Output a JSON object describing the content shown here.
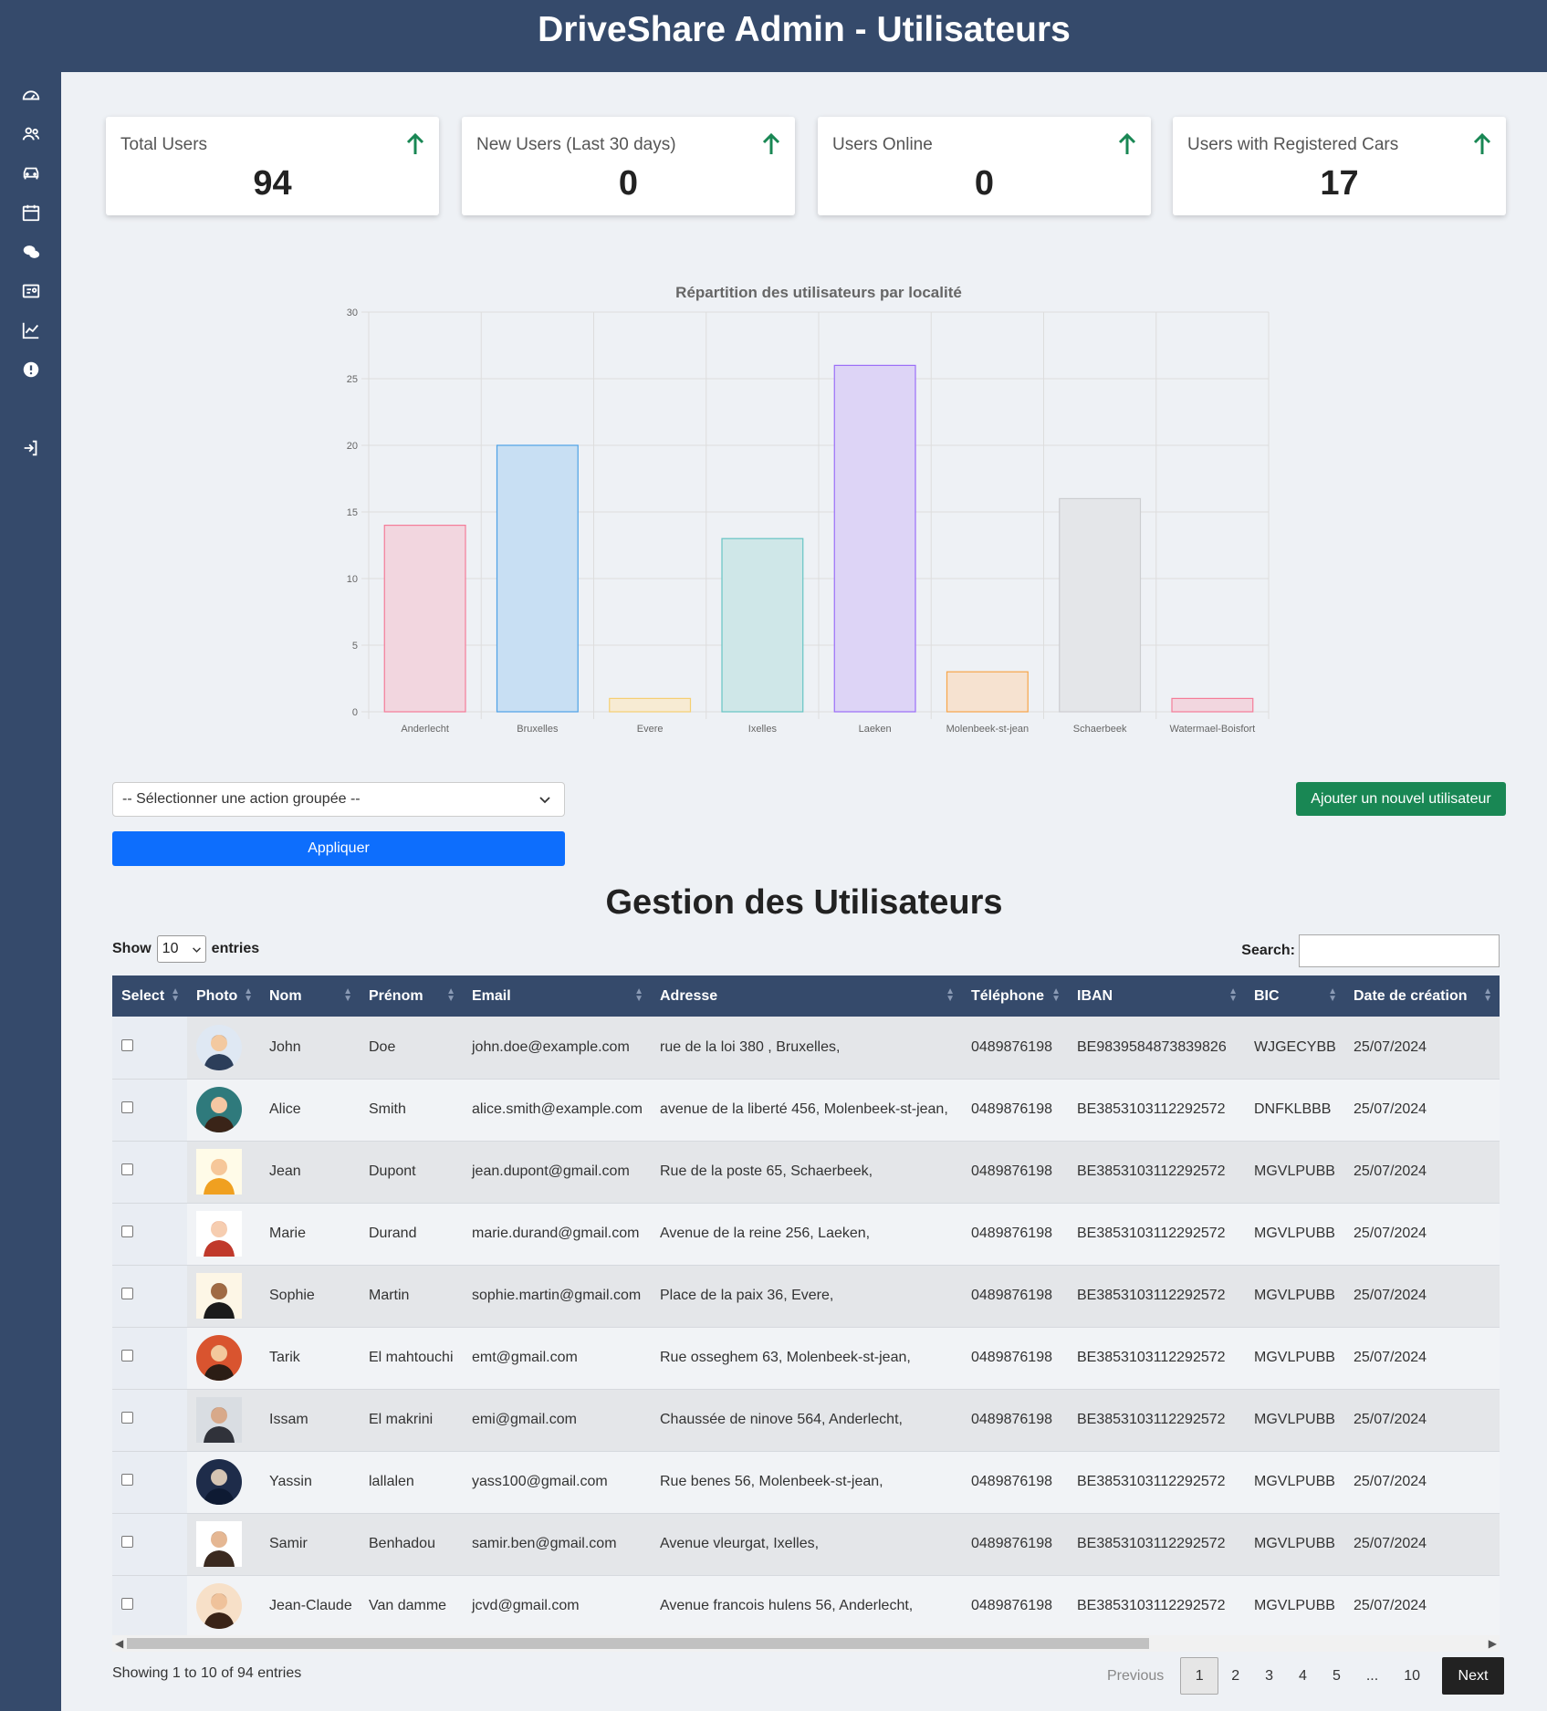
{
  "header": {
    "title": "DriveShare Admin - Utilisateurs"
  },
  "sidebar": {
    "items": [
      {
        "icon": "grid-icon"
      },
      {
        "icon": "dashboard-icon"
      },
      {
        "icon": "users-icon"
      },
      {
        "icon": "car-icon"
      },
      {
        "icon": "calendar-icon"
      },
      {
        "icon": "chat-icon"
      },
      {
        "icon": "id-card-icon"
      },
      {
        "icon": "chart-icon"
      },
      {
        "icon": "alert-icon"
      },
      {
        "icon": "logout-icon"
      }
    ]
  },
  "stats": [
    {
      "label": "Total Users",
      "value": "94"
    },
    {
      "label": "New Users (Last 30 days)",
      "value": "0"
    },
    {
      "label": "Users Online",
      "value": "0"
    },
    {
      "label": "Users with Registered Cars",
      "value": "17"
    }
  ],
  "colors": {
    "primary": "#354a6b",
    "apply": "#0d6efd",
    "add": "#198754",
    "arrow": "#198754"
  },
  "chart_data": {
    "type": "bar",
    "title": "Répartition des utilisateurs par localité",
    "categories": [
      "Anderlecht",
      "Bruxelles",
      "Evere",
      "Ixelles",
      "Laeken",
      "Molenbeek-st-jean",
      "Schaerbeek",
      "Watermael-Boisfort"
    ],
    "values": [
      14,
      20,
      1,
      13,
      26,
      3,
      16,
      1
    ],
    "ylim": [
      0,
      30
    ],
    "yticks": [
      0,
      5,
      10,
      15,
      20,
      25,
      30
    ],
    "grid": true,
    "colors": [
      {
        "fill": "#f2d6df",
        "stroke": "#f47c98"
      },
      {
        "fill": "#c8dff3",
        "stroke": "#4ea1e6"
      },
      {
        "fill": "#f7ebd3",
        "stroke": "#f5cf72"
      },
      {
        "fill": "#cfe7e8",
        "stroke": "#66c4c4"
      },
      {
        "fill": "#ddd4f6",
        "stroke": "#9b6ef7"
      },
      {
        "fill": "#f6e2d0",
        "stroke": "#f7a54a"
      },
      {
        "fill": "#e4e6e9",
        "stroke": "#cccdd0"
      },
      {
        "fill": "#f2d6df",
        "stroke": "#f47c98"
      }
    ]
  },
  "controls": {
    "action_select": "-- Sélectionner une action groupée --",
    "apply_label": "Appliquer",
    "add_label": "Ajouter un nouvel utilisateur"
  },
  "section_title": "Gestion des Utilisateurs",
  "table_controls": {
    "show_label": "Show",
    "entries_value": "10",
    "entries_label": "entries",
    "search_label": "Search:"
  },
  "table": {
    "columns": [
      "Select",
      "Photo",
      "Nom",
      "Prénom",
      "Email",
      "Adresse",
      "Téléphone",
      "IBAN",
      "BIC",
      "Date de création"
    ],
    "rows": [
      {
        "nom": "John",
        "prenom": "Doe",
        "email": "john.doe@example.com",
        "adresse": "rue de la loi 380 , Bruxelles,",
        "tel": "0489876198",
        "iban": "BE9839584873839826",
        "bic": "WJGECYBB",
        "date": "25/07/2024",
        "avatar": "avatar-businessman"
      },
      {
        "nom": "Alice",
        "prenom": "Smith",
        "email": "alice.smith@example.com",
        "adresse": "avenue de la liberté 456, Molenbeek-st-jean,",
        "tel": "0489876198",
        "iban": "BE3853103112292572",
        "bic": "DNFKLBBB",
        "date": "25/07/2024",
        "avatar": "avatar-woman"
      },
      {
        "nom": "Jean",
        "prenom": "Dupont",
        "email": "jean.dupont@gmail.com",
        "adresse": "Rue de la poste 65, Schaerbeek,",
        "tel": "0489876198",
        "iban": "BE3853103112292572",
        "bic": "MGVLPUBB",
        "date": "25/07/2024",
        "avatar": "avatar-man-orange"
      },
      {
        "nom": "Marie",
        "prenom": "Durand",
        "email": "marie.durand@gmail.com",
        "adresse": "Avenue de la reine 256, Laeken,",
        "tel": "0489876198",
        "iban": "BE3853103112292572",
        "bic": "MGVLPUBB",
        "date": "25/07/2024",
        "avatar": "avatar-woman-redhair"
      },
      {
        "nom": "Sophie",
        "prenom": "Martin",
        "email": "sophie.martin@gmail.com",
        "adresse": "Place de la paix 36, Evere,",
        "tel": "0489876198",
        "iban": "BE3853103112292572",
        "bic": "MGVLPUBB",
        "date": "25/07/2024",
        "avatar": "avatar-woman-dark"
      },
      {
        "nom": "Tarik",
        "prenom": "El mahtouchi",
        "email": "emt@gmail.com",
        "adresse": "Rue osseghem 63, Molenbeek-st-jean,",
        "tel": "0489876198",
        "iban": "BE3853103112292572",
        "bic": "MGVLPUBB",
        "date": "25/07/2024",
        "avatar": "avatar-man-red"
      },
      {
        "nom": "Issam",
        "prenom": "El makrini",
        "email": "emi@gmail.com",
        "adresse": "Chaussée de ninove 564, Anderlecht,",
        "tel": "0489876198",
        "iban": "BE3853103112292572",
        "bic": "MGVLPUBB",
        "date": "25/07/2024",
        "avatar": "avatar-man-photo"
      },
      {
        "nom": "Yassin",
        "prenom": "lallalen",
        "email": "yass100@gmail.com",
        "adresse": "Rue benes 56, Molenbeek-st-jean,",
        "tel": "0489876198",
        "iban": "BE3853103112292572",
        "bic": "MGVLPUBB",
        "date": "25/07/2024",
        "avatar": "avatar-ninja"
      },
      {
        "nom": "Samir",
        "prenom": "Benhadou",
        "email": "samir.ben@gmail.com",
        "adresse": "Avenue vleurgat, Ixelles,",
        "tel": "0489876198",
        "iban": "BE3853103112292572",
        "bic": "MGVLPUBB",
        "date": "25/07/2024",
        "avatar": "avatar-beard"
      },
      {
        "nom": "Jean-Claude",
        "prenom": "Van damme",
        "email": "jcvd@gmail.com",
        "adresse": "Avenue francois hulens 56, Anderlecht,",
        "tel": "0489876198",
        "iban": "BE3853103112292572",
        "bic": "MGVLPUBB",
        "date": "25/07/2024",
        "avatar": "avatar-glasses"
      }
    ]
  },
  "footer": {
    "info": "Showing 1 to 10 of 94 entries",
    "previous": "Previous",
    "pages": [
      "1",
      "2",
      "3",
      "4",
      "5",
      "...",
      "10"
    ],
    "next": "Next"
  }
}
